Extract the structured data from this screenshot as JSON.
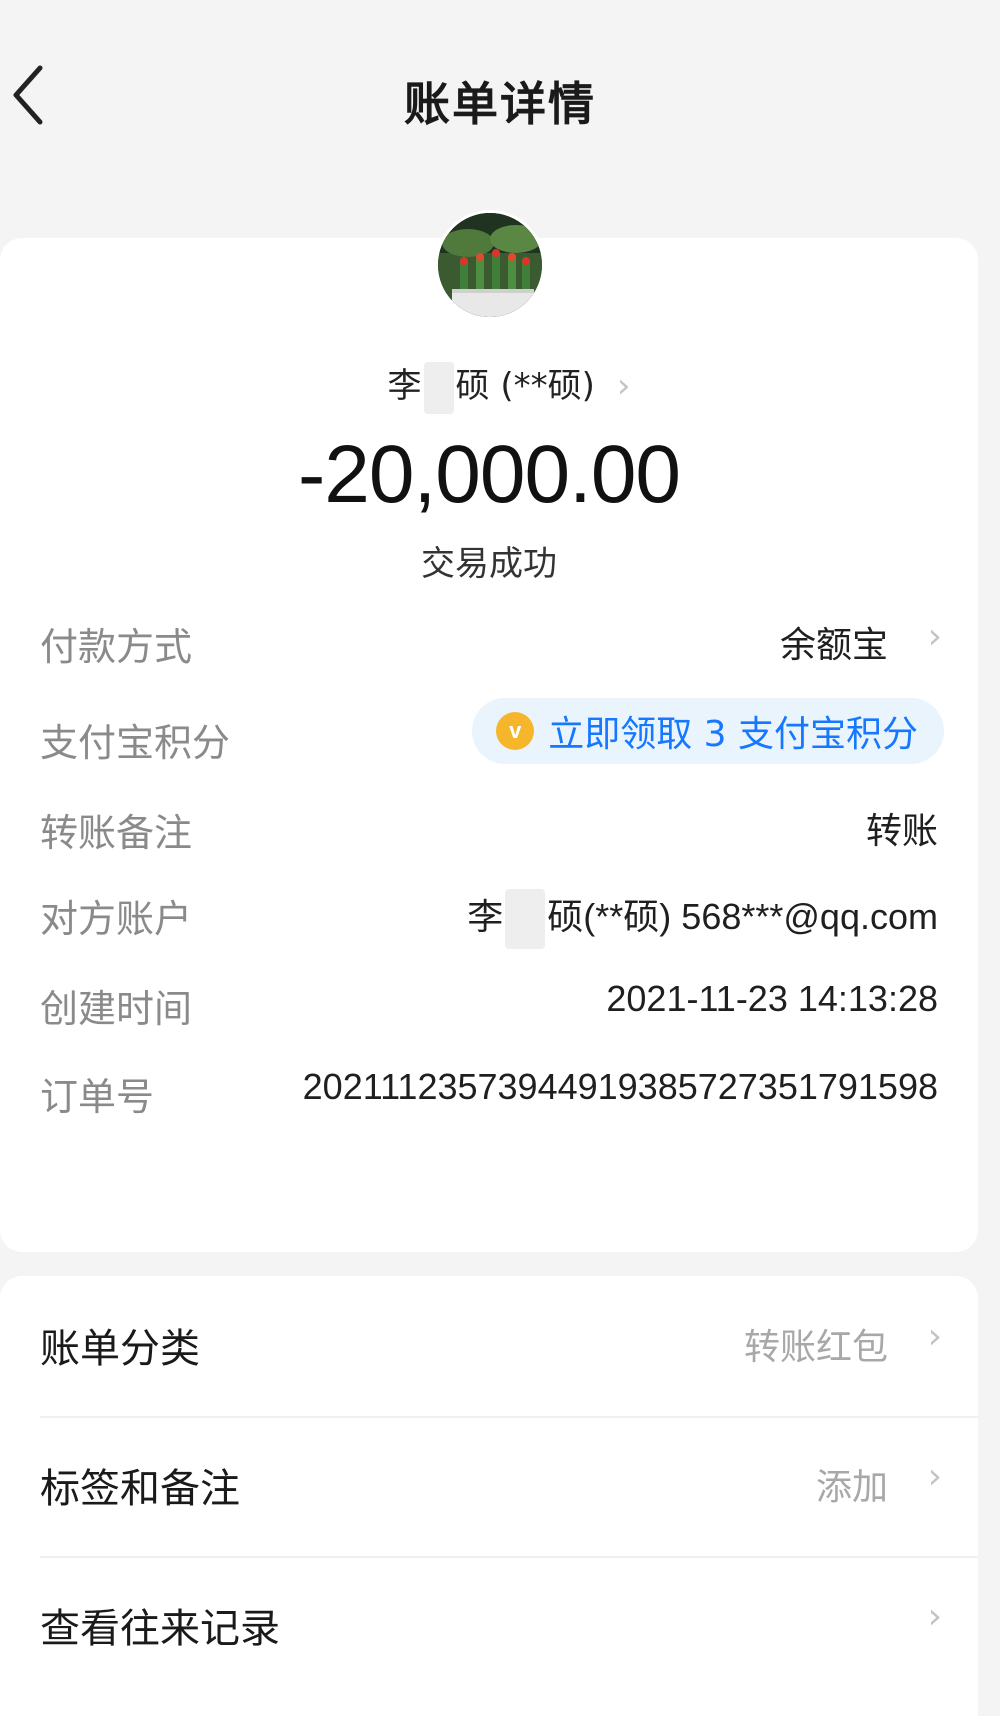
{
  "nav": {
    "title": "账单详情",
    "back_icon": "chevron-left-icon"
  },
  "payee": {
    "name_prefix": "李",
    "name_suffix": "硕 (**硕)",
    "chevron": "›"
  },
  "transaction": {
    "amount": "-20,000.00",
    "status": "交易成功"
  },
  "details": {
    "payment_method_label": "付款方式",
    "payment_method_value": "余额宝",
    "points_label": "支付宝积分",
    "points_coin": "v",
    "points_value": "立即领取 3 支付宝积分",
    "remark_label": "转账备注",
    "remark_value": "转账",
    "account_label": "对方账户",
    "account_prefix": "李",
    "account_suffix": "硕(**硕) 568***@qq.com",
    "created_label": "创建时间",
    "created_value": "2021-11-23 14:13:28",
    "order_label": "订单号",
    "order_value": "20211123573944919385727351791598"
  },
  "options": {
    "category_label": "账单分类",
    "category_value": "转账红包",
    "tags_label": "标签和备注",
    "tags_value": "添加",
    "history_label": "查看往来记录"
  },
  "colors": {
    "background": "#f4f4f4",
    "card": "#ffffff",
    "link_blue": "#1677ff",
    "pill_bg": "#eaf4fd",
    "coin_gold": "#f5b62b",
    "label_gray": "#8a8a8a"
  }
}
